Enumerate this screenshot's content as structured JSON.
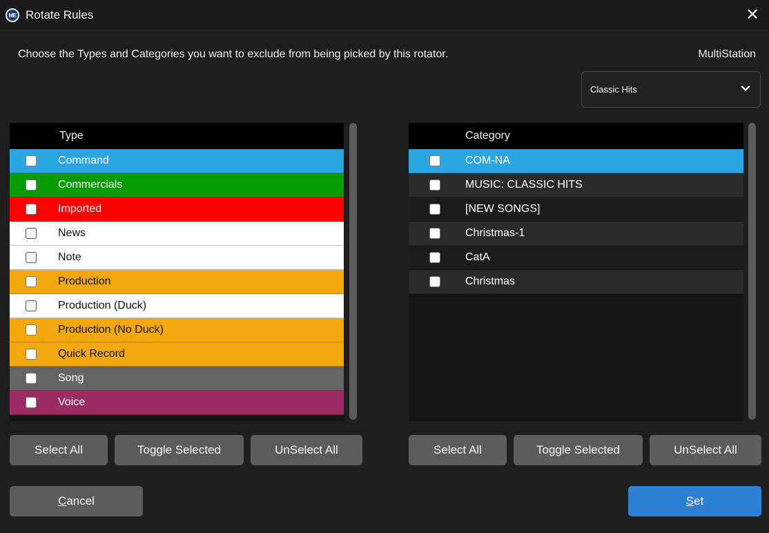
{
  "window": {
    "icon_text": "ME",
    "title": "Rotate Rules",
    "close_symbol": "✕"
  },
  "instructions": "Choose the Types and Categories you want to exclude from being picked by this rotator.",
  "station": {
    "label": "MultiStation",
    "selected": "Classic Hits"
  },
  "types": {
    "header": "Type",
    "items": [
      {
        "label": "Command",
        "bg": "#2ba6e2",
        "fg": "#ffffff",
        "checked": false
      },
      {
        "label": "Commercials",
        "bg": "#079a07",
        "fg": "#ffffff",
        "checked": false
      },
      {
        "label": "Imported",
        "bg": "#ff0000",
        "fg": "#ffffff",
        "checked": false
      },
      {
        "label": "News",
        "bg": "#ffffff",
        "fg": "#111111",
        "checked": false
      },
      {
        "label": "Note",
        "bg": "#ffffff",
        "fg": "#111111",
        "checked": false
      },
      {
        "label": "Production",
        "bg": "#f3a810",
        "fg": "#111111",
        "checked": false
      },
      {
        "label": "Production (Duck)",
        "bg": "#ffffff",
        "fg": "#111111",
        "checked": false
      },
      {
        "label": "Production (No Duck)",
        "bg": "#f3a810",
        "fg": "#111111",
        "checked": false
      },
      {
        "label": "Quick Record",
        "bg": "#f3a810",
        "fg": "#111111",
        "checked": false
      },
      {
        "label": "Song",
        "bg": "#646464",
        "fg": "#ffffff",
        "checked": false
      },
      {
        "label": "Voice",
        "bg": "#9b2b62",
        "fg": "#ffffff",
        "checked": false
      }
    ]
  },
  "categories": {
    "header": "Category",
    "items": [
      {
        "label": "COM-NA",
        "bg": "#2ba6e2",
        "checked": false
      },
      {
        "label": "MUSIC: CLASSIC HITS",
        "bg": "#2b2b2b",
        "checked": false
      },
      {
        "label": "[NEW SONGS]",
        "bg": "#1c1c1c",
        "checked": false
      },
      {
        "label": "Christmas-1",
        "bg": "#2b2b2b",
        "checked": false
      },
      {
        "label": "CatA",
        "bg": "#1c1c1c",
        "checked": false
      },
      {
        "label": "Christmas",
        "bg": "#2b2b2b",
        "checked": false
      }
    ]
  },
  "type_buttons": {
    "select_all": "Select All",
    "toggle": "Toggle Selected",
    "unselect_all": "UnSelect All"
  },
  "category_buttons": {
    "select_all": "Select All",
    "toggle": "Toggle Selected",
    "unselect_all": "UnSelect All"
  },
  "footer": {
    "cancel_mnemonic": "C",
    "cancel_rest": "ancel",
    "set_mnemonic": "S",
    "set_rest": "et"
  },
  "colors": {
    "accent": "#2d7fd6",
    "selection": "#2ba6e2"
  }
}
